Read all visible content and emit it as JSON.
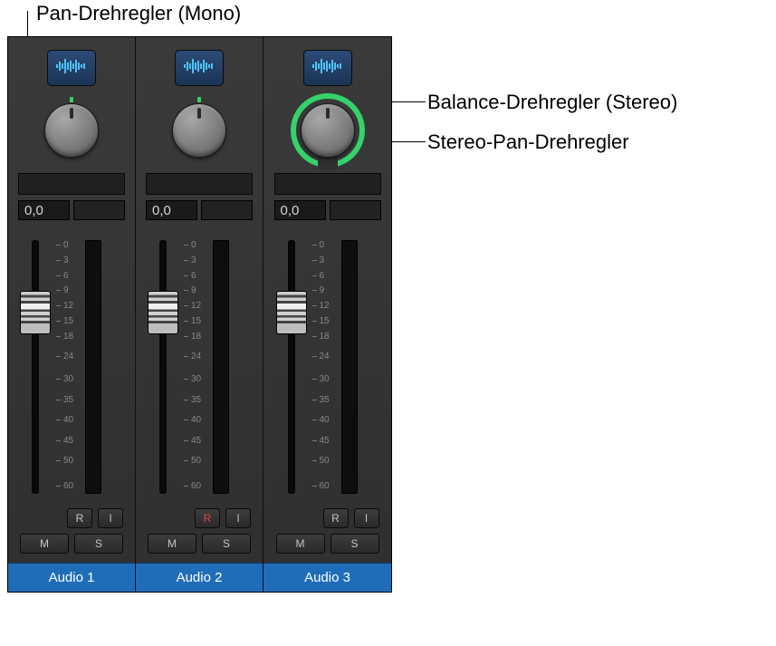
{
  "annotations": {
    "mono": "Pan-Drehregler (Mono)",
    "balance": "Balance-Drehregler (Stereo)",
    "stereo_pan": "Stereo-Pan-Drehregler"
  },
  "scale": [
    "0",
    "3",
    "6",
    "9",
    "12",
    "15",
    "18",
    "24",
    "30",
    "35",
    "40",
    "45",
    "50",
    "60"
  ],
  "buttons": {
    "r": "R",
    "i": "I",
    "m": "M",
    "s": "S"
  },
  "strips": [
    {
      "value": "0,0",
      "label": "Audio 1",
      "rec": false,
      "ring": false
    },
    {
      "value": "0,0",
      "label": "Audio 2",
      "rec": true,
      "ring": false
    },
    {
      "value": "0,0",
      "label": "Audio 3",
      "rec": false,
      "ring": true
    }
  ]
}
